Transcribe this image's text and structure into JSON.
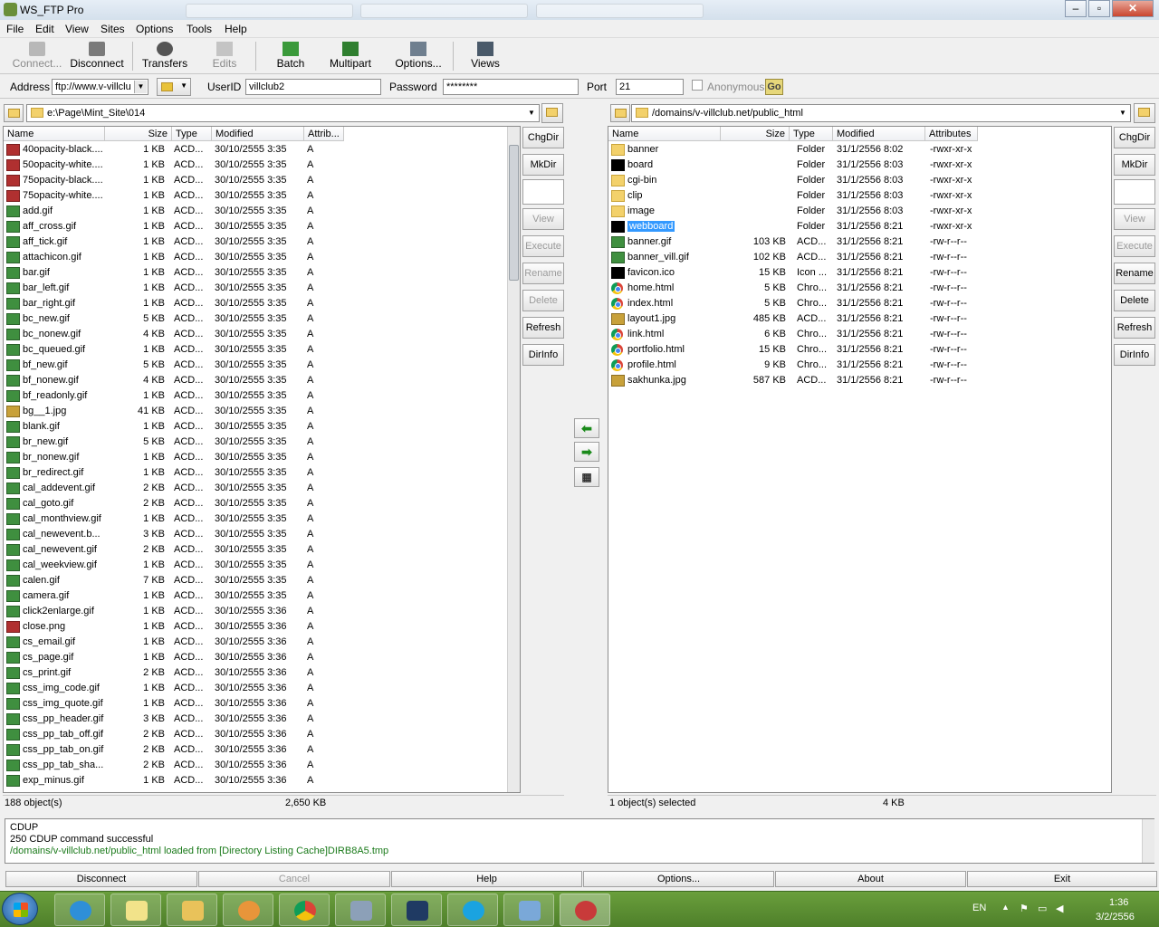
{
  "window": {
    "title": "WS_FTP Pro"
  },
  "menu": [
    "File",
    "Edit",
    "View",
    "Sites",
    "Options",
    "Tools",
    "Help"
  ],
  "toolbar": {
    "connect": "Connect...",
    "disconnect": "Disconnect",
    "transfers": "Transfers",
    "edits": "Edits",
    "batch": "Batch",
    "multipart": "Multipart",
    "options": "Options...",
    "views": "Views"
  },
  "address_bar": {
    "address_label": "Address",
    "address_value": "ftp://www.v-villclu",
    "userid_label": "UserID",
    "userid_value": "villclub2",
    "password_label": "Password",
    "password_value": "********",
    "port_label": "Port",
    "port_value": "21",
    "anonymous_label": "Anonymous",
    "go_label": "Go"
  },
  "local": {
    "path": "e:\\Page\\Mint_Site\\014",
    "columns": [
      "Name",
      "Size",
      "Type",
      "Modified",
      "Attrib..."
    ],
    "files": [
      {
        "icon": "png",
        "name": "40opacity-black....",
        "size": "1 KB",
        "type": "ACD...",
        "modified": "30/10/2555 3:35",
        "attr": "A"
      },
      {
        "icon": "png",
        "name": "50opacity-white....",
        "size": "1 KB",
        "type": "ACD...",
        "modified": "30/10/2555 3:35",
        "attr": "A"
      },
      {
        "icon": "png",
        "name": "75opacity-black....",
        "size": "1 KB",
        "type": "ACD...",
        "modified": "30/10/2555 3:35",
        "attr": "A"
      },
      {
        "icon": "png",
        "name": "75opacity-white....",
        "size": "1 KB",
        "type": "ACD...",
        "modified": "30/10/2555 3:35",
        "attr": "A"
      },
      {
        "icon": "gif",
        "name": "add.gif",
        "size": "1 KB",
        "type": "ACD...",
        "modified": "30/10/2555 3:35",
        "attr": "A"
      },
      {
        "icon": "gif",
        "name": "aff_cross.gif",
        "size": "1 KB",
        "type": "ACD...",
        "modified": "30/10/2555 3:35",
        "attr": "A"
      },
      {
        "icon": "gif",
        "name": "aff_tick.gif",
        "size": "1 KB",
        "type": "ACD...",
        "modified": "30/10/2555 3:35",
        "attr": "A"
      },
      {
        "icon": "gif",
        "name": "attachicon.gif",
        "size": "1 KB",
        "type": "ACD...",
        "modified": "30/10/2555 3:35",
        "attr": "A"
      },
      {
        "icon": "gif",
        "name": "bar.gif",
        "size": "1 KB",
        "type": "ACD...",
        "modified": "30/10/2555 3:35",
        "attr": "A"
      },
      {
        "icon": "gif",
        "name": "bar_left.gif",
        "size": "1 KB",
        "type": "ACD...",
        "modified": "30/10/2555 3:35",
        "attr": "A"
      },
      {
        "icon": "gif",
        "name": "bar_right.gif",
        "size": "1 KB",
        "type": "ACD...",
        "modified": "30/10/2555 3:35",
        "attr": "A"
      },
      {
        "icon": "gif",
        "name": "bc_new.gif",
        "size": "5 KB",
        "type": "ACD...",
        "modified": "30/10/2555 3:35",
        "attr": "A"
      },
      {
        "icon": "gif",
        "name": "bc_nonew.gif",
        "size": "4 KB",
        "type": "ACD...",
        "modified": "30/10/2555 3:35",
        "attr": "A"
      },
      {
        "icon": "gif",
        "name": "bc_queued.gif",
        "size": "1 KB",
        "type": "ACD...",
        "modified": "30/10/2555 3:35",
        "attr": "A"
      },
      {
        "icon": "gif",
        "name": "bf_new.gif",
        "size": "5 KB",
        "type": "ACD...",
        "modified": "30/10/2555 3:35",
        "attr": "A"
      },
      {
        "icon": "gif",
        "name": "bf_nonew.gif",
        "size": "4 KB",
        "type": "ACD...",
        "modified": "30/10/2555 3:35",
        "attr": "A"
      },
      {
        "icon": "gif",
        "name": "bf_readonly.gif",
        "size": "1 KB",
        "type": "ACD...",
        "modified": "30/10/2555 3:35",
        "attr": "A"
      },
      {
        "icon": "jpg",
        "name": "bg__1.jpg",
        "size": "41 KB",
        "type": "ACD...",
        "modified": "30/10/2555 3:35",
        "attr": "A"
      },
      {
        "icon": "gif",
        "name": "blank.gif",
        "size": "1 KB",
        "type": "ACD...",
        "modified": "30/10/2555 3:35",
        "attr": "A"
      },
      {
        "icon": "gif",
        "name": "br_new.gif",
        "size": "5 KB",
        "type": "ACD...",
        "modified": "30/10/2555 3:35",
        "attr": "A"
      },
      {
        "icon": "gif",
        "name": "br_nonew.gif",
        "size": "1 KB",
        "type": "ACD...",
        "modified": "30/10/2555 3:35",
        "attr": "A"
      },
      {
        "icon": "gif",
        "name": "br_redirect.gif",
        "size": "1 KB",
        "type": "ACD...",
        "modified": "30/10/2555 3:35",
        "attr": "A"
      },
      {
        "icon": "gif",
        "name": "cal_addevent.gif",
        "size": "2 KB",
        "type": "ACD...",
        "modified": "30/10/2555 3:35",
        "attr": "A"
      },
      {
        "icon": "gif",
        "name": "cal_goto.gif",
        "size": "2 KB",
        "type": "ACD...",
        "modified": "30/10/2555 3:35",
        "attr": "A"
      },
      {
        "icon": "gif",
        "name": "cal_monthview.gif",
        "size": "1 KB",
        "type": "ACD...",
        "modified": "30/10/2555 3:35",
        "attr": "A"
      },
      {
        "icon": "gif",
        "name": "cal_newevent.b...",
        "size": "3 KB",
        "type": "ACD...",
        "modified": "30/10/2555 3:35",
        "attr": "A"
      },
      {
        "icon": "gif",
        "name": "cal_newevent.gif",
        "size": "2 KB",
        "type": "ACD...",
        "modified": "30/10/2555 3:35",
        "attr": "A"
      },
      {
        "icon": "gif",
        "name": "cal_weekview.gif",
        "size": "1 KB",
        "type": "ACD...",
        "modified": "30/10/2555 3:35",
        "attr": "A"
      },
      {
        "icon": "gif",
        "name": "calen.gif",
        "size": "7 KB",
        "type": "ACD...",
        "modified": "30/10/2555 3:35",
        "attr": "A"
      },
      {
        "icon": "gif",
        "name": "camera.gif",
        "size": "1 KB",
        "type": "ACD...",
        "modified": "30/10/2555 3:35",
        "attr": "A"
      },
      {
        "icon": "gif",
        "name": "click2enlarge.gif",
        "size": "1 KB",
        "type": "ACD...",
        "modified": "30/10/2555 3:36",
        "attr": "A"
      },
      {
        "icon": "png",
        "name": "close.png",
        "size": "1 KB",
        "type": "ACD...",
        "modified": "30/10/2555 3:36",
        "attr": "A"
      },
      {
        "icon": "gif",
        "name": "cs_email.gif",
        "size": "1 KB",
        "type": "ACD...",
        "modified": "30/10/2555 3:36",
        "attr": "A"
      },
      {
        "icon": "gif",
        "name": "cs_page.gif",
        "size": "1 KB",
        "type": "ACD...",
        "modified": "30/10/2555 3:36",
        "attr": "A"
      },
      {
        "icon": "gif",
        "name": "cs_print.gif",
        "size": "2 KB",
        "type": "ACD...",
        "modified": "30/10/2555 3:36",
        "attr": "A"
      },
      {
        "icon": "gif",
        "name": "css_img_code.gif",
        "size": "1 KB",
        "type": "ACD...",
        "modified": "30/10/2555 3:36",
        "attr": "A"
      },
      {
        "icon": "gif",
        "name": "css_img_quote.gif",
        "size": "1 KB",
        "type": "ACD...",
        "modified": "30/10/2555 3:36",
        "attr": "A"
      },
      {
        "icon": "gif",
        "name": "css_pp_header.gif",
        "size": "3 KB",
        "type": "ACD...",
        "modified": "30/10/2555 3:36",
        "attr": "A"
      },
      {
        "icon": "gif",
        "name": "css_pp_tab_off.gif",
        "size": "2 KB",
        "type": "ACD...",
        "modified": "30/10/2555 3:36",
        "attr": "A"
      },
      {
        "icon": "gif",
        "name": "css_pp_tab_on.gif",
        "size": "2 KB",
        "type": "ACD...",
        "modified": "30/10/2555 3:36",
        "attr": "A"
      },
      {
        "icon": "gif",
        "name": "css_pp_tab_sha...",
        "size": "2 KB",
        "type": "ACD...",
        "modified": "30/10/2555 3:36",
        "attr": "A"
      },
      {
        "icon": "gif",
        "name": "exp_minus.gif",
        "size": "1 KB",
        "type": "ACD...",
        "modified": "30/10/2555 3:36",
        "attr": "A"
      }
    ],
    "status_count": "188 object(s)",
    "status_size": "2,650 KB",
    "buttons": [
      "ChgDir",
      "MkDir",
      "View",
      "Execute",
      "Rename",
      "Delete",
      "Refresh",
      "DirInfo"
    ]
  },
  "remote": {
    "path": "/domains/v-villclub.net/public_html",
    "columns": [
      "Name",
      "Size",
      "Type",
      "Modified",
      "Attributes"
    ],
    "files": [
      {
        "icon": "folder",
        "name": "banner",
        "size": "",
        "type": "Folder",
        "modified": "31/1/2556 8:02",
        "attr": "-rwxr-xr-x"
      },
      {
        "icon": "black",
        "name": "board",
        "size": "",
        "type": "Folder",
        "modified": "31/1/2556 8:03",
        "attr": "-rwxr-xr-x"
      },
      {
        "icon": "folder",
        "name": "cgi-bin",
        "size": "",
        "type": "Folder",
        "modified": "31/1/2556 8:03",
        "attr": "-rwxr-xr-x"
      },
      {
        "icon": "folder",
        "name": "clip",
        "size": "",
        "type": "Folder",
        "modified": "31/1/2556 8:03",
        "attr": "-rwxr-xr-x"
      },
      {
        "icon": "folder",
        "name": "image",
        "size": "",
        "type": "Folder",
        "modified": "31/1/2556 8:03",
        "attr": "-rwxr-xr-x"
      },
      {
        "icon": "black",
        "name": "webboard",
        "size": "",
        "type": "Folder",
        "modified": "31/1/2556 8:21",
        "attr": "-rwxr-xr-x",
        "selected": true
      },
      {
        "icon": "gif",
        "name": "banner.gif",
        "size": "103 KB",
        "type": "ACD...",
        "modified": "31/1/2556 8:21",
        "attr": "-rw-r--r--"
      },
      {
        "icon": "gif",
        "name": "banner_vill.gif",
        "size": "102 KB",
        "type": "ACD...",
        "modified": "31/1/2556 8:21",
        "attr": "-rw-r--r--"
      },
      {
        "icon": "black",
        "name": "favicon.ico",
        "size": "15 KB",
        "type": "Icon ...",
        "modified": "31/1/2556 8:21",
        "attr": "-rw-r--r--"
      },
      {
        "icon": "chrome",
        "name": "home.html",
        "size": "5 KB",
        "type": "Chro...",
        "modified": "31/1/2556 8:21",
        "attr": "-rw-r--r--"
      },
      {
        "icon": "chrome",
        "name": "index.html",
        "size": "5 KB",
        "type": "Chro...",
        "modified": "31/1/2556 8:21",
        "attr": "-rw-r--r--"
      },
      {
        "icon": "jpg",
        "name": "layout1.jpg",
        "size": "485 KB",
        "type": "ACD...",
        "modified": "31/1/2556 8:21",
        "attr": "-rw-r--r--"
      },
      {
        "icon": "chrome",
        "name": "link.html",
        "size": "6 KB",
        "type": "Chro...",
        "modified": "31/1/2556 8:21",
        "attr": "-rw-r--r--"
      },
      {
        "icon": "chrome",
        "name": "portfolio.html",
        "size": "15 KB",
        "type": "Chro...",
        "modified": "31/1/2556 8:21",
        "attr": "-rw-r--r--"
      },
      {
        "icon": "chrome",
        "name": "profile.html",
        "size": "9 KB",
        "type": "Chro...",
        "modified": "31/1/2556 8:21",
        "attr": "-rw-r--r--"
      },
      {
        "icon": "jpg",
        "name": "sakhunka.jpg",
        "size": "587 KB",
        "type": "ACD...",
        "modified": "31/1/2556 8:21",
        "attr": "-rw-r--r--"
      }
    ],
    "status_count": "1 object(s) selected",
    "status_size": "4 KB",
    "buttons": [
      "ChgDir",
      "MkDir",
      "View",
      "Execute",
      "Rename",
      "Delete",
      "Refresh",
      "DirInfo"
    ]
  },
  "log": [
    {
      "text": "CDUP",
      "color": "#000000"
    },
    {
      "text": "250 CDUP command successful",
      "color": "#000000"
    },
    {
      "text": "/domains/v-villclub.net/public_html  loaded from [Directory Listing Cache]DIRB8A5.tmp",
      "color": "#1a7a1a"
    }
  ],
  "bottom_buttons": [
    "Disconnect",
    "Cancel",
    "Help",
    "Options...",
    "About",
    "Exit"
  ],
  "tray": {
    "lang": "EN",
    "time": "1:36",
    "date": "3/2/2556"
  }
}
